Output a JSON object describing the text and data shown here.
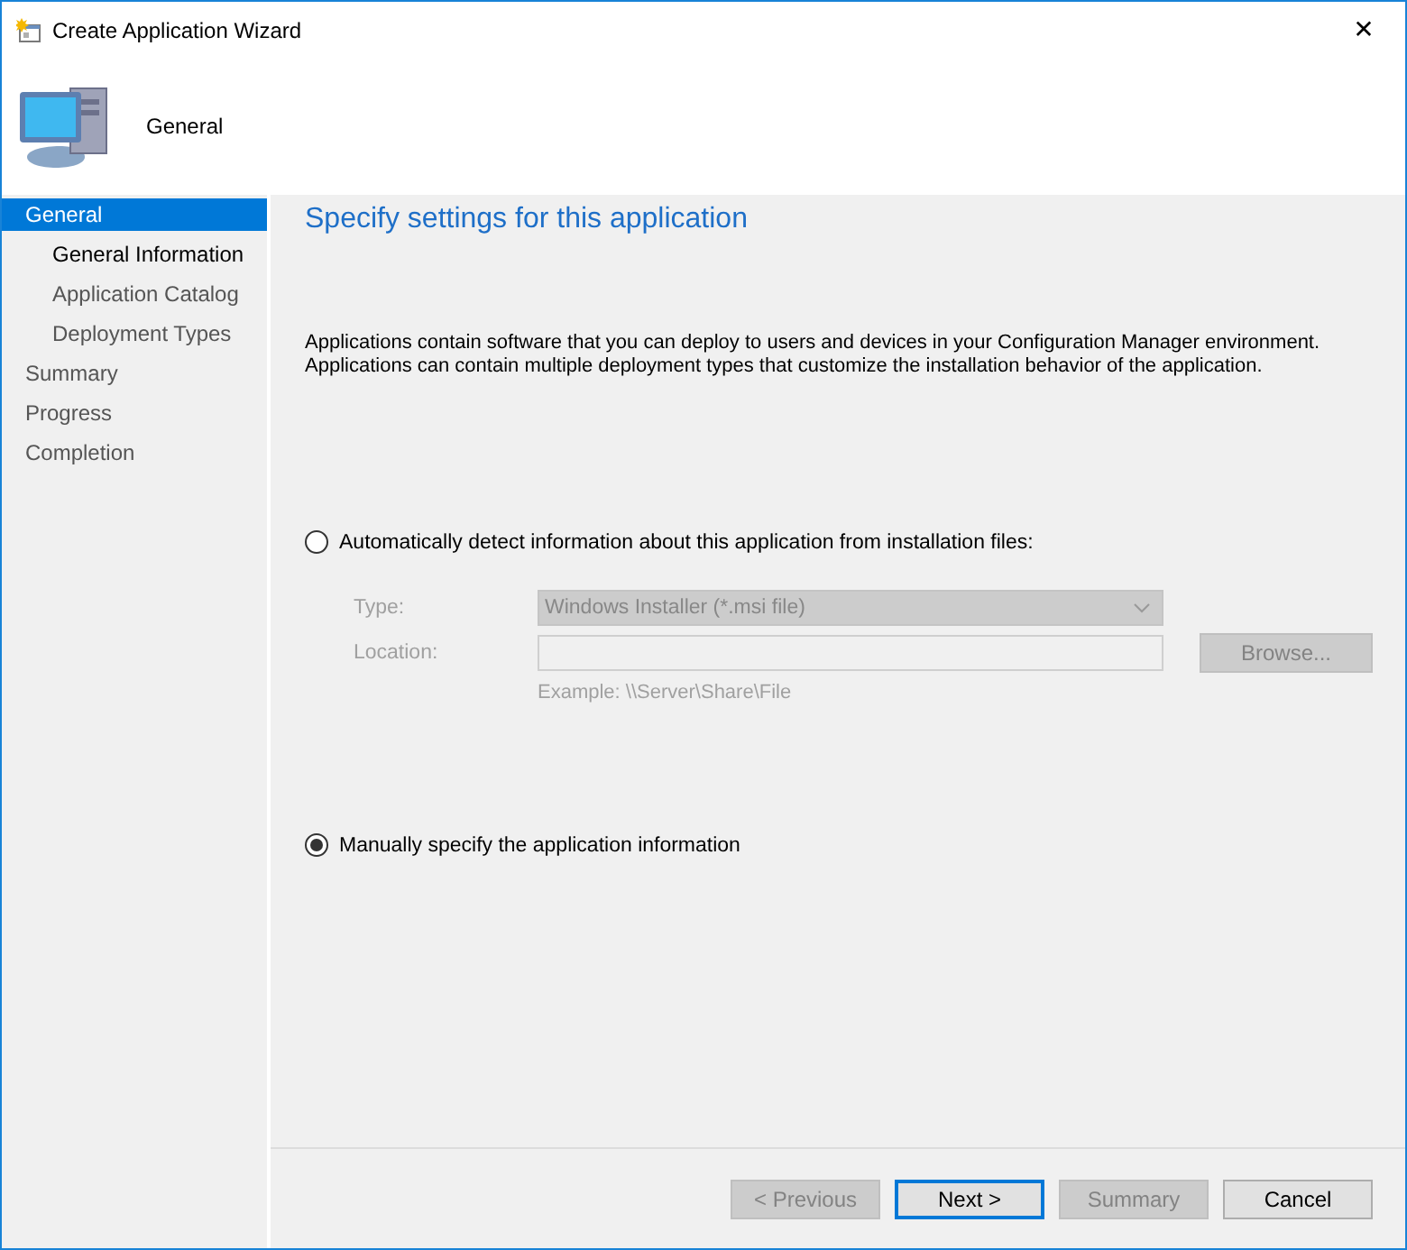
{
  "window": {
    "title": "Create Application Wizard",
    "close": "✕"
  },
  "header": {
    "title": "General"
  },
  "steps": [
    {
      "label": "General",
      "selected": true,
      "enabled": true,
      "children": [
        {
          "label": "General Information",
          "selected": false,
          "enabled": true
        },
        {
          "label": "Application Catalog",
          "selected": false,
          "enabled": false
        },
        {
          "label": "Deployment Types",
          "selected": false,
          "enabled": false
        }
      ]
    },
    {
      "label": "Summary",
      "selected": false,
      "enabled": false
    },
    {
      "label": "Progress",
      "selected": false,
      "enabled": false
    },
    {
      "label": "Completion",
      "selected": false,
      "enabled": false
    }
  ],
  "page": {
    "heading": "Specify settings for this application",
    "description": "Applications contain software that you can deploy to users and devices in your Configuration Manager environment. Applications can contain multiple deployment types that customize the installation behavior of the application.",
    "options": [
      {
        "label": "Automatically detect information about this application from installation files:",
        "selected": false,
        "fields": {
          "disabled": true,
          "type_label": "Type:",
          "type_value": "Windows Installer (*.msi file)",
          "location_label": "Location:",
          "browse": "Browse...",
          "example": "Example: \\\\Server\\Share\\File"
        }
      },
      {
        "label": "Manually specify the application information",
        "selected": true
      }
    ]
  },
  "buttons": [
    {
      "label": "< Previous",
      "disabled": true,
      "default": false
    },
    {
      "label": "Next >",
      "disabled": false,
      "default": true
    },
    {
      "label": "Summary",
      "disabled": true,
      "default": false
    },
    {
      "label": "Cancel",
      "disabled": false,
      "default": false
    }
  ]
}
